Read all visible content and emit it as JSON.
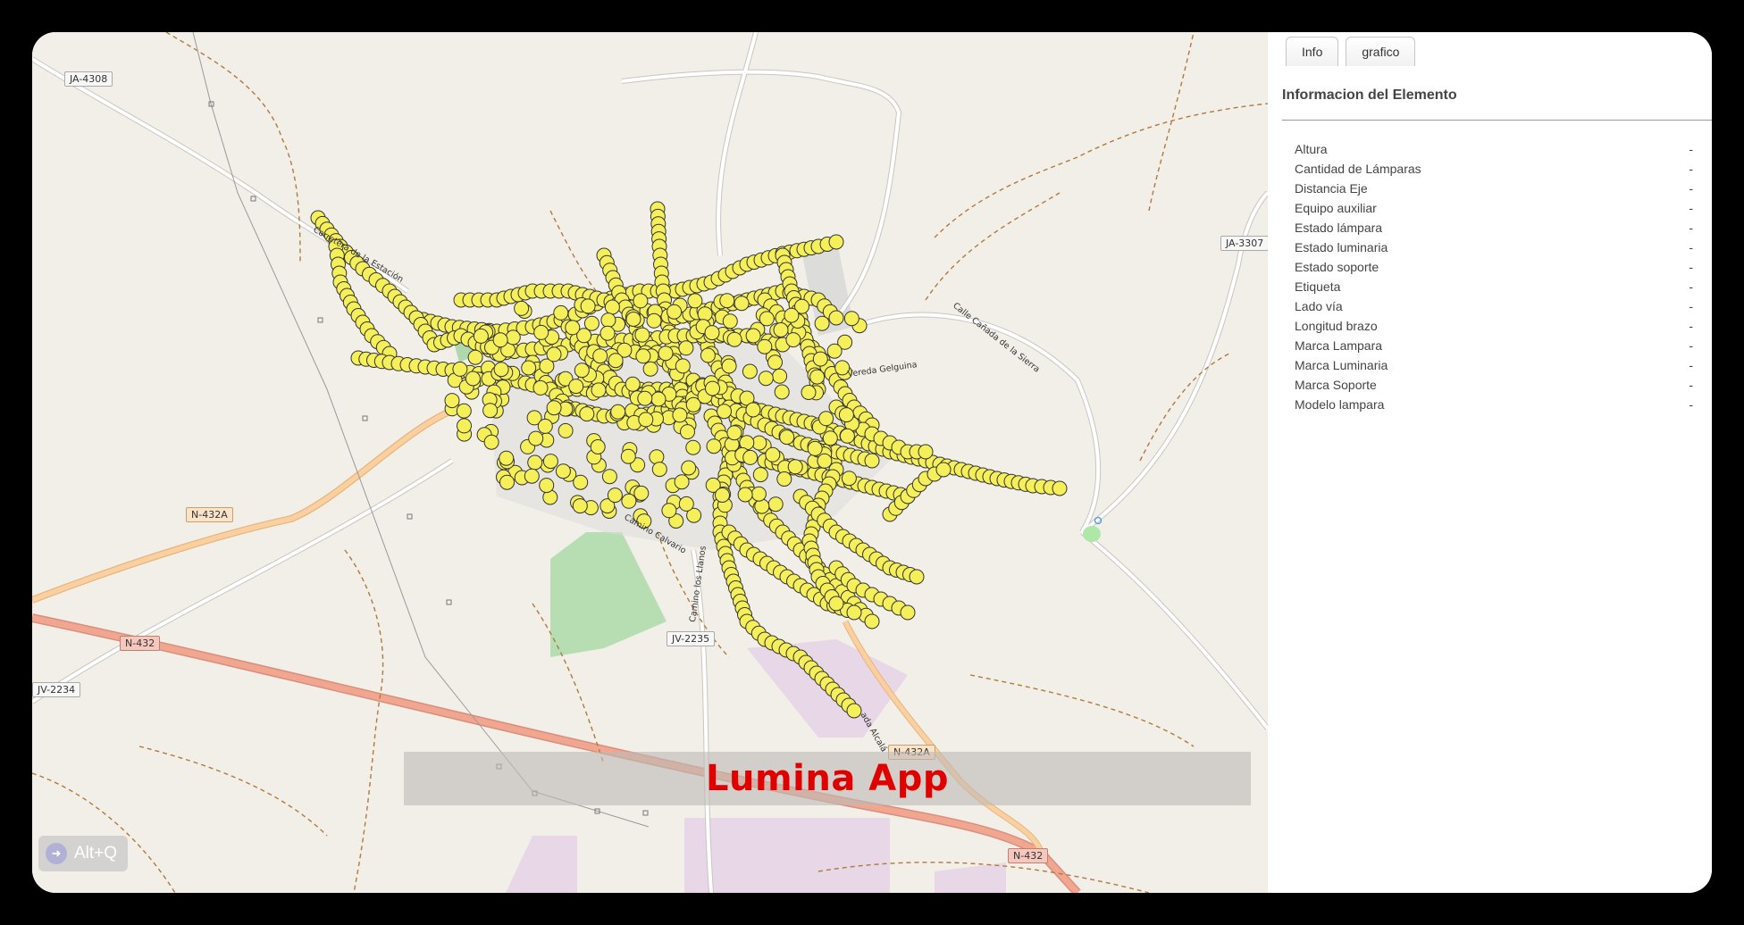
{
  "map": {
    "road_shields": [
      {
        "id": "ja4308",
        "text": "JA-4308"
      },
      {
        "id": "ja3307",
        "text": "JA-3307"
      },
      {
        "id": "n432a_w",
        "text": "N-432A"
      },
      {
        "id": "n432_w",
        "text": "N-432"
      },
      {
        "id": "jv2234",
        "text": "JV-2234"
      },
      {
        "id": "jv2235",
        "text": "JV-2235"
      },
      {
        "id": "n432a_s",
        "text": "N-432A"
      },
      {
        "id": "n432_e",
        "text": "N-432"
      }
    ],
    "street_labels": {
      "estacion": "Carretera de la Estación",
      "canada": "Calle Cañada de la Sierra",
      "gelguina": "Vereda Gelguina",
      "calvario": "Camino Calvario",
      "llanos": "Camino los Llanos",
      "alcala": "ada Alcalá"
    },
    "marker_color": "#f5f05a",
    "banner_text": "Lumina App",
    "shortcut_hint": "Alt+Q"
  },
  "panel": {
    "tabs": [
      {
        "label": "Info"
      },
      {
        "label": "grafico"
      }
    ],
    "title": "Informacion del Elemento",
    "attributes": [
      {
        "label": "Altura",
        "value": "-"
      },
      {
        "label": "Cantidad de Lámparas",
        "value": "-"
      },
      {
        "label": "Distancia Eje",
        "value": "-"
      },
      {
        "label": "Equipo auxiliar",
        "value": "-"
      },
      {
        "label": "Estado lámpara",
        "value": "-"
      },
      {
        "label": "Estado luminaria",
        "value": "-"
      },
      {
        "label": "Estado soporte",
        "value": "-"
      },
      {
        "label": "Etiqueta",
        "value": "-"
      },
      {
        "label": "Lado vía",
        "value": "-"
      },
      {
        "label": "Longitud brazo",
        "value": "-"
      },
      {
        "label": "Marca Lampara",
        "value": "-"
      },
      {
        "label": "Marca Luminaria",
        "value": "-"
      },
      {
        "label": "Marca Soporte",
        "value": "-"
      },
      {
        "label": "Modelo lampara",
        "value": "-"
      }
    ]
  }
}
